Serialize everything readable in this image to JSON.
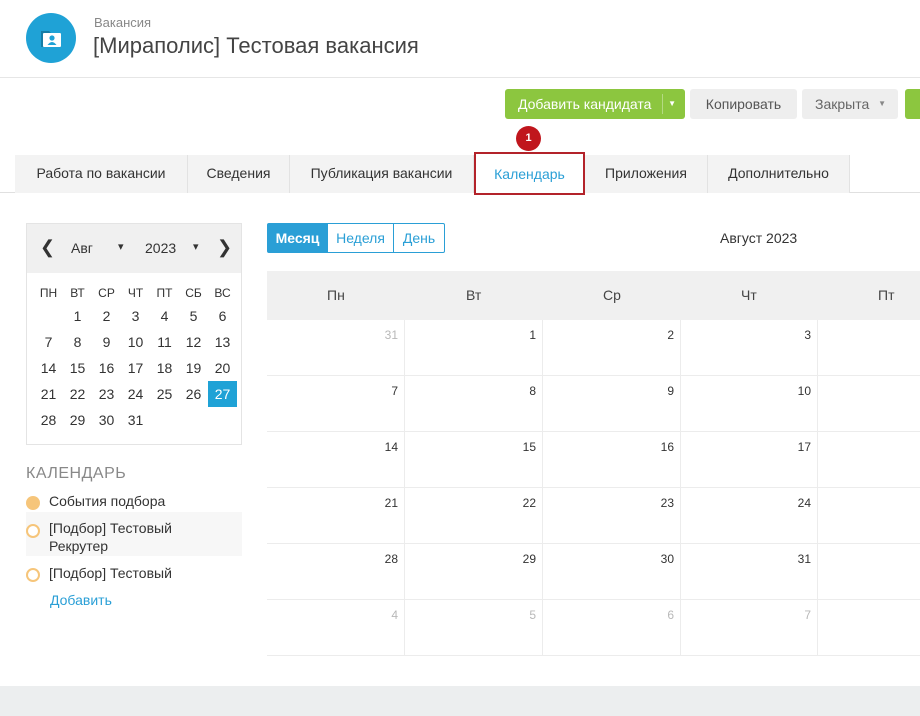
{
  "header": {
    "subtitle": "Вакансия",
    "title": "[Мираполис] Тестовая вакансия",
    "avatar_icon": "contact-card-icon"
  },
  "toolbar": {
    "add_candidate": "Добавить кандидата",
    "copy": "Копировать",
    "close": "Закрыта"
  },
  "badge": "1",
  "tabs": [
    "Работа по вакансии",
    "Сведения",
    "Публикация вакансии",
    "Календарь",
    "Приложения",
    "Дополнительно"
  ],
  "mini_calendar": {
    "month": "Авг",
    "year": "2023",
    "weekdays": [
      "ПН",
      "ВТ",
      "СР",
      "ЧТ",
      "ПТ",
      "СБ",
      "ВС"
    ],
    "selected_day": "27"
  },
  "calendars": {
    "heading": "КАЛЕНДАРЬ",
    "items": [
      "События подбора",
      "[Подбор] Тестовый Рекрутер",
      "[Подбор] Тестовый"
    ],
    "add_link": "Добавить"
  },
  "main_calendar": {
    "views": [
      "Месяц",
      "Неделя",
      "День"
    ],
    "active_view": "Месяц",
    "title": "Август 2023",
    "day_names": [
      "Пн",
      "Вт",
      "Ср",
      "Чт",
      "Пт"
    ],
    "weeks": [
      [
        "31",
        "1",
        "2",
        "3"
      ],
      [
        "7",
        "8",
        "9",
        "10"
      ],
      [
        "14",
        "15",
        "16",
        "17"
      ],
      [
        "21",
        "22",
        "23",
        "24"
      ],
      [
        "28",
        "29",
        "30",
        "31"
      ],
      [
        "4",
        "5",
        "6",
        "7"
      ]
    ]
  },
  "colors": {
    "accent": "#2a9fd6",
    "primary_button": "#8cc63f",
    "badge": "#c0161d",
    "event_dot": "#f6c57a"
  }
}
